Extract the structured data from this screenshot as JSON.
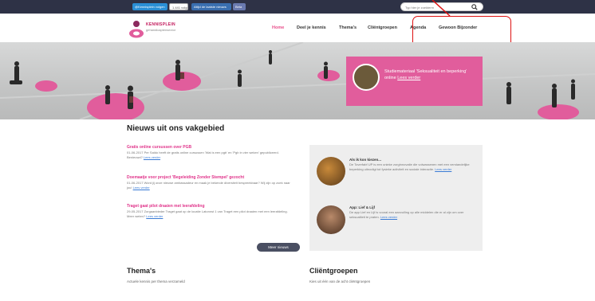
{
  "topbar": {
    "twitter_label": "@Kennisplein volgen",
    "follower_count": "1.441 volgers",
    "rss_label": "Altijd de laatste nieuws",
    "beta_label": "Beta",
    "search_placeholder": "Typ hier je zoekterm"
  },
  "brand": {
    "name": "KENNISPLEIN",
    "tagline": "gehandicaptensector"
  },
  "nav": {
    "items": [
      {
        "label": "Home",
        "active": true
      },
      {
        "label": "Deel je kennis",
        "active": false
      },
      {
        "label": "Thema's",
        "active": false
      },
      {
        "label": "Cliëntgroepen",
        "active": false
      },
      {
        "label": "Agenda",
        "active": false
      },
      {
        "label": "Gewoon Bijzonder",
        "active": false
      }
    ]
  },
  "hero": {
    "callout_text": "Studiemateriaal 'Seksualiteit en beperking' online",
    "callout_link": "Lees verder"
  },
  "news": {
    "title": "Nieuws uit ons vakgebied",
    "items": [
      {
        "headline": "Gratis online cursussen over PGB",
        "body": "01-06-2017 Per Saldo heeft de gratis online cursussen 'Wat is een pgb' en 'Pgb in vier weken' gepubliceerd. Benieuwd?",
        "link": "Lees verder"
      },
      {
        "headline": "Doemaatje voor project 'Begeleiding Zonder Stempel' gezocht",
        "body": "01-06-2017 Word jij onze nieuwe ambassadeur en maak je bekende diversiteit bespreekbaar? Wij zijn op zoek naar jou!",
        "link": "Lees verder"
      },
      {
        "headline": "Traget gaat pilot draaien met leerafdeling",
        "body": "29-05-2017 Zorgaanbieder Traget gaat op de locatie Latonnst 1 van Traget een pilot draaien met een leerafdeling. Meer weten?",
        "link": "Lees verder"
      }
    ],
    "more_label": "Meer nieuws"
  },
  "side": {
    "items": [
      {
        "title": "Als ik kon kiezen...",
        "body": "De Toverfabf UP is een unieke zorginnovatie die volwassenen met een verstandelijke beperking uitnodigt tot fysieke activiteit en sociale interactie.",
        "link": "Lees verder"
      },
      {
        "title": "App: Lief & Lijf",
        "body": "De app Lief en Lijf is vooral een aanvulling op alle middelen die er al zijn om over seksualiteit te praten.",
        "link": "Lees verder"
      }
    ]
  },
  "sections": {
    "themas_title": "Thema's",
    "themas_sub": "Actuele kennis per thema verzameld",
    "client_title": "Cliëntgroepen",
    "client_sub": "Kies uit één van de acht cliëntgroepen"
  },
  "colors": {
    "accent": "#e15d9c",
    "topbar": "#2e3246",
    "highlight": "#dd1111"
  }
}
